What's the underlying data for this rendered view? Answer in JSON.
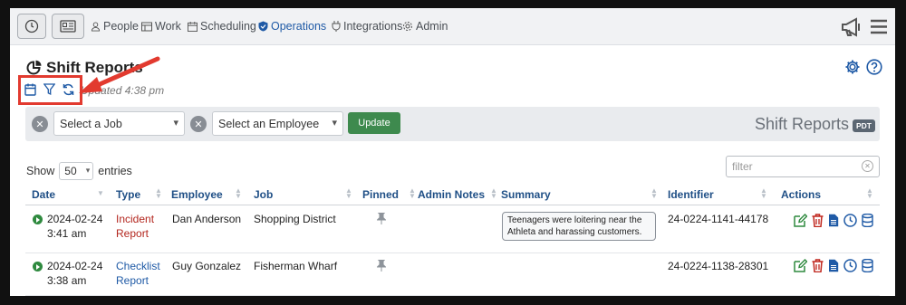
{
  "nav": {
    "items": [
      "People",
      "Work",
      "Scheduling",
      "Operations",
      "Integrations",
      "Admin"
    ],
    "active": "Operations"
  },
  "header": {
    "title": "Shift Reports",
    "updated": "Updated 4:38 pm"
  },
  "filters": {
    "job_placeholder": "Select a Job",
    "employee_placeholder": "Select an Employee",
    "update_label": "Update",
    "section_label": "Shift Reports",
    "timezone_badge": "PDT"
  },
  "table_controls": {
    "show_label": "Show",
    "entries_value": "50",
    "entries_label": "entries",
    "filter_placeholder": "filter"
  },
  "table": {
    "columns": [
      "Date",
      "Type",
      "Employee",
      "Job",
      "Pinned",
      "Admin Notes",
      "Summary",
      "Identifier",
      "Actions"
    ],
    "rows": [
      {
        "date": "2024-02-24",
        "time": "3:41 am",
        "type_line1": "Incident",
        "type_line2": "Report",
        "employee": "Dan Anderson",
        "job": "Shopping District",
        "admin_notes": "",
        "summary": "Teenagers were loitering near the Athleta and harassing customers.",
        "identifier": "24-0224-1141-44178"
      },
      {
        "date": "2024-02-24",
        "time": "3:38 am",
        "type_line1": "Checklist",
        "type_line2": "Report",
        "employee": "Guy Gonzalez",
        "job": "Fisherman Wharf",
        "admin_notes": "",
        "summary": "",
        "identifier": "24-0224-1138-28301"
      }
    ]
  },
  "colors": {
    "accent": "#1f5aa6",
    "update_button": "#3e8a4e",
    "incident": "#b3261e",
    "highlight": "#e23a2f"
  },
  "icons": [
    "dashboard-icon",
    "news-icon",
    "calendar-icon",
    "filter-icon",
    "refresh-icon",
    "gear-icon",
    "help-icon",
    "megaphone-icon",
    "menu-icon",
    "edit-icon",
    "delete-icon",
    "document-icon",
    "clock-icon",
    "database-icon",
    "pin-icon"
  ]
}
